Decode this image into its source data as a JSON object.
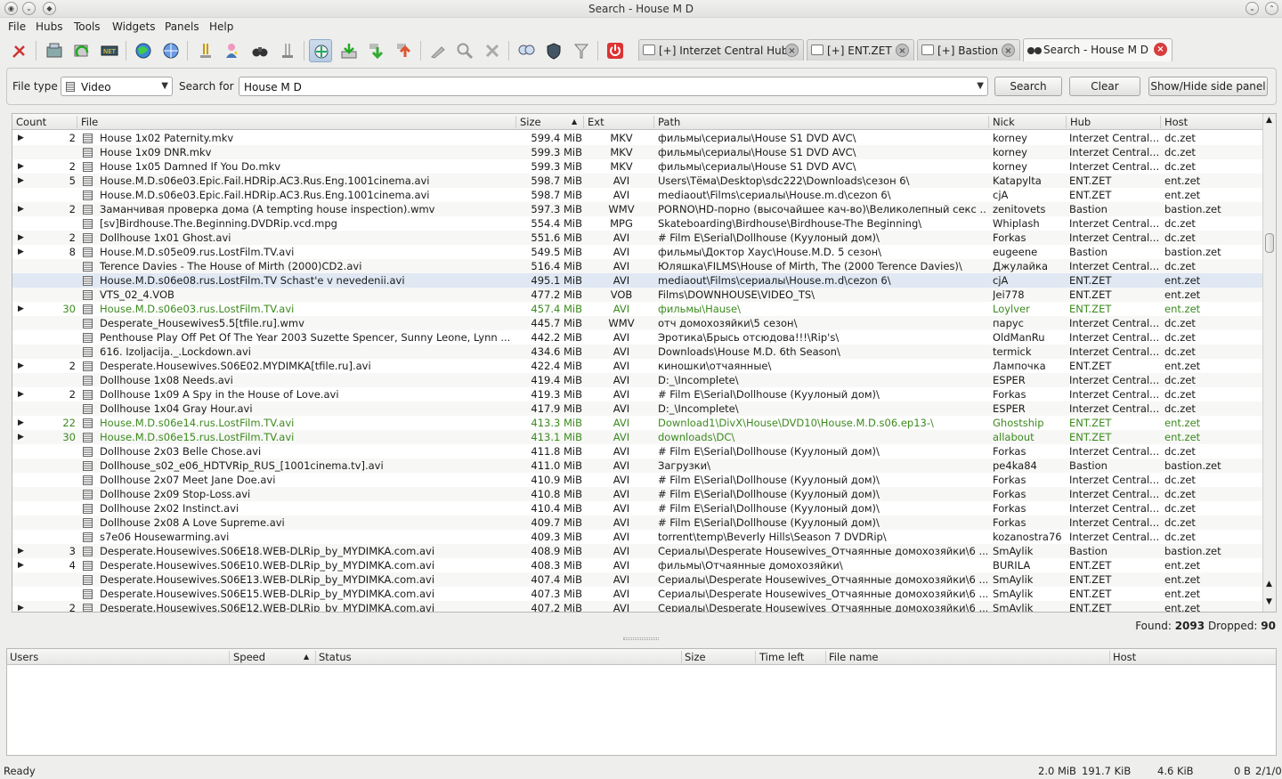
{
  "window": {
    "title": "Search - House M D"
  },
  "menu": [
    "File",
    "Hubs",
    "Tools",
    "Widgets",
    "Panels",
    "Help"
  ],
  "tabs": [
    {
      "label": "[+] Interzet Central Hub"
    },
    {
      "label": "[+] ENT.ZET"
    },
    {
      "label": "[+] Bastion"
    },
    {
      "label": "Search - House M D"
    }
  ],
  "search": {
    "file_type_label": "File type",
    "file_type_value": "Video",
    "search_for_label": "Search for",
    "query": "House M D",
    "search_button": "Search",
    "clear_button": "Clear",
    "side_panel_button": "Show/Hide side panel"
  },
  "columns": {
    "count": "Count",
    "file": "File",
    "size": "Size",
    "ext": "Ext",
    "path": "Path",
    "nick": "Nick",
    "hub": "Hub",
    "host": "Host"
  },
  "rows": [
    {
      "exp": true,
      "count": "2",
      "file": "House 1x02 Paternity.mkv",
      "size": "599.4 MiB",
      "ext": "MKV",
      "path": "фильмы\\сериалы\\House S1 DVD AVC\\",
      "nick": "korney",
      "hub": "Interzet Central...",
      "host": "dc.zet"
    },
    {
      "exp": false,
      "count": "",
      "file": "House 1x09 DNR.mkv",
      "size": "599.3 MiB",
      "ext": "MKV",
      "path": "фильмы\\сериалы\\House S1 DVD AVC\\",
      "nick": "korney",
      "hub": "Interzet Central...",
      "host": "dc.zet"
    },
    {
      "exp": true,
      "count": "2",
      "file": "House 1x05 Damned If You Do.mkv",
      "size": "599.3 MiB",
      "ext": "MKV",
      "path": "фильмы\\сериалы\\House S1 DVD AVC\\",
      "nick": "korney",
      "hub": "Interzet Central...",
      "host": "dc.zet"
    },
    {
      "exp": true,
      "count": "5",
      "file": "House.M.D.s06e03.Epic.Fail.HDRip.AC3.Rus.Eng.1001cinema.avi",
      "size": "598.7 MiB",
      "ext": "AVI",
      "path": "Users\\Тёма\\Desktop\\sdc222\\Downloads\\сезон 6\\",
      "nick": "Katapylta",
      "hub": "ENT.ZET",
      "host": "ent.zet"
    },
    {
      "exp": false,
      "count": "",
      "file": "House.M.D.s06e03.Epic.Fail.HDRip.AC3.Rus.Eng.1001cinema.avi",
      "size": "598.7 MiB",
      "ext": "AVI",
      "path": "mediaout\\Films\\сериалы\\House.m.d\\cezon 6\\",
      "nick": "cjA",
      "hub": "ENT.ZET",
      "host": "ent.zet"
    },
    {
      "exp": true,
      "count": "2",
      "file": "Заманчивая проверка дома (A tempting house inspection).wmv",
      "size": "597.3 MiB",
      "ext": "WMV",
      "path": "PORNO\\HD-порно (высочайшее кач-во)\\Великолепный секс ...",
      "nick": "zenitovets",
      "hub": "Bastion",
      "host": "bastion.zet"
    },
    {
      "exp": false,
      "count": "",
      "file": "[sv]Birdhouse.The.Beginning.DVDRip.vcd.mpg",
      "size": "554.4 MiB",
      "ext": "MPG",
      "path": "Skateboarding\\Birdhouse\\Birdhouse-The Beginning\\",
      "nick": "Whiplash",
      "hub": "Interzet Central...",
      "host": "dc.zet"
    },
    {
      "exp": true,
      "count": "2",
      "file": "Dollhouse 1x01 Ghost.avi",
      "size": "551.6 MiB",
      "ext": "AVI",
      "path": "# Film E\\Serial\\Dollhouse (Куулоный дом)\\",
      "nick": "Forkas",
      "hub": "Interzet Central...",
      "host": "dc.zet"
    },
    {
      "exp": true,
      "count": "8",
      "file": "House.M.D.s05e09.rus.LostFilm.TV.avi",
      "size": "549.5 MiB",
      "ext": "AVI",
      "path": "фильмы\\Доктор Хаус\\House.M.D. 5 сезон\\",
      "nick": "eugeene",
      "hub": "Bastion",
      "host": "bastion.zet"
    },
    {
      "exp": false,
      "count": "",
      "file": "Terence Davies - The House of Mirth (2000)CD2.avi",
      "size": "516.4 MiB",
      "ext": "AVI",
      "path": "Юляшка\\FILMS\\House of Mirth, The (2000 Terence Davies)\\",
      "nick": "Джулайка",
      "hub": "Interzet Central...",
      "host": "dc.zet"
    },
    {
      "exp": false,
      "count": "",
      "file": "House.M.D.s06e08.rus.LostFilm.TV Schast'e v nevedenii.avi",
      "size": "495.1 MiB",
      "ext": "AVI",
      "path": "mediaout\\Films\\сериалы\\House.m.d\\cezon 6\\",
      "nick": "cjA",
      "hub": "ENT.ZET",
      "host": "ent.zet",
      "sel": true
    },
    {
      "exp": false,
      "count": "",
      "file": "VTS_02_4.VOB",
      "size": "477.2 MiB",
      "ext": "VOB",
      "path": "Films\\DOWNHOUSE\\VIDEO_TS\\",
      "nick": "Jei778",
      "hub": "ENT.ZET",
      "host": "ent.zet"
    },
    {
      "exp": true,
      "count": "30",
      "file": "House.M.D.s06e03.rus.LostFilm.TV.avi",
      "size": "457.4 MiB",
      "ext": "AVI",
      "path": "фильмы\\Hause\\",
      "nick": "Loylver",
      "hub": "ENT.ZET",
      "host": "ent.zet",
      "green": true
    },
    {
      "exp": false,
      "count": "",
      "file": "Desperate_Housewives5.5[tfile.ru].wmv",
      "size": "445.7 MiB",
      "ext": "WMV",
      "path": "отч домохозяйки\\5 сезон\\",
      "nick": "парус",
      "hub": "Interzet Central...",
      "host": "dc.zet"
    },
    {
      "exp": false,
      "count": "",
      "file": "Penthouse Play Off Pet Of The Year 2003 Suzette Spencer, Sunny Leone, Lynn ...",
      "size": "442.2 MiB",
      "ext": "AVI",
      "path": "Эротика\\Брысь отсюдова!!!\\Rip's\\",
      "nick": "OldManRu",
      "hub": "Interzet Central...",
      "host": "dc.zet"
    },
    {
      "exp": false,
      "count": "",
      "file": "616. Izoljacija._.Lockdown.avi",
      "size": "434.6 MiB",
      "ext": "AVI",
      "path": "Downloads\\House M.D. 6th Season\\",
      "nick": "termick",
      "hub": "Interzet Central...",
      "host": "dc.zet"
    },
    {
      "exp": true,
      "count": "2",
      "file": "Desperate.Housewives.S06E02.MYDIMKA[tfile.ru].avi",
      "size": "422.4 MiB",
      "ext": "AVI",
      "path": "киношки\\отчаянные\\",
      "nick": "Лампочка",
      "hub": "ENT.ZET",
      "host": "ent.zet"
    },
    {
      "exp": false,
      "count": "",
      "file": "Dollhouse 1x08 Needs.avi",
      "size": "419.4 MiB",
      "ext": "AVI",
      "path": "D:_\\Incomplete\\",
      "nick": "ESPER",
      "hub": "Interzet Central...",
      "host": "dc.zet"
    },
    {
      "exp": true,
      "count": "2",
      "file": "Dollhouse 1x09 A Spy in the House of Love.avi",
      "size": "419.3 MiB",
      "ext": "AVI",
      "path": "# Film E\\Serial\\Dollhouse (Куулоный дом)\\",
      "nick": "Forkas",
      "hub": "Interzet Central...",
      "host": "dc.zet"
    },
    {
      "exp": false,
      "count": "",
      "file": "Dollhouse 1x04 Gray Hour.avi",
      "size": "417.9 MiB",
      "ext": "AVI",
      "path": "D:_\\Incomplete\\",
      "nick": "ESPER",
      "hub": "Interzet Central...",
      "host": "dc.zet"
    },
    {
      "exp": true,
      "count": "22",
      "file": "House.M.D.s06e14.rus.LostFilm.TV.avi",
      "size": "413.3 MiB",
      "ext": "AVI",
      "path": "Download1\\DivX\\House\\DVD10\\House.M.D.s06.ep13-\\",
      "nick": "Ghostship",
      "hub": "ENT.ZET",
      "host": "ent.zet",
      "green": true
    },
    {
      "exp": true,
      "count": "30",
      "file": "House.M.D.s06e15.rus.LostFilm.TV.avi",
      "size": "413.1 MiB",
      "ext": "AVI",
      "path": "downloads\\DC\\",
      "nick": "allabout",
      "hub": "ENT.ZET",
      "host": "ent.zet",
      "green": true
    },
    {
      "exp": false,
      "count": "",
      "file": "Dollhouse 2x03 Belle Chose.avi",
      "size": "411.8 MiB",
      "ext": "AVI",
      "path": "# Film E\\Serial\\Dollhouse (Куулоный дом)\\",
      "nick": "Forkas",
      "hub": "Interzet Central...",
      "host": "dc.zet"
    },
    {
      "exp": false,
      "count": "",
      "file": "Dollhouse_s02_e06_HDTVRip_RUS_[1001cinema.tv].avi",
      "size": "411.0 MiB",
      "ext": "AVI",
      "path": "Загрузки\\",
      "nick": "pe4ka84",
      "hub": "Bastion",
      "host": "bastion.zet"
    },
    {
      "exp": false,
      "count": "",
      "file": "Dollhouse 2x07 Meet Jane Doe.avi",
      "size": "410.9 MiB",
      "ext": "AVI",
      "path": "# Film E\\Serial\\Dollhouse (Куулоный дом)\\",
      "nick": "Forkas",
      "hub": "Interzet Central...",
      "host": "dc.zet"
    },
    {
      "exp": false,
      "count": "",
      "file": "Dollhouse 2x09 Stop-Loss.avi",
      "size": "410.8 MiB",
      "ext": "AVI",
      "path": "# Film E\\Serial\\Dollhouse (Куулоный дом)\\",
      "nick": "Forkas",
      "hub": "Interzet Central...",
      "host": "dc.zet"
    },
    {
      "exp": false,
      "count": "",
      "file": "Dollhouse 2x02 Instinct.avi",
      "size": "410.4 MiB",
      "ext": "AVI",
      "path": "# Film E\\Serial\\Dollhouse (Куулоный дом)\\",
      "nick": "Forkas",
      "hub": "Interzet Central...",
      "host": "dc.zet"
    },
    {
      "exp": false,
      "count": "",
      "file": "Dollhouse 2x08 A Love Supreme.avi",
      "size": "409.7 MiB",
      "ext": "AVI",
      "path": "# Film E\\Serial\\Dollhouse (Куулоный дом)\\",
      "nick": "Forkas",
      "hub": "Interzet Central...",
      "host": "dc.zet"
    },
    {
      "exp": false,
      "count": "",
      "file": "s7e06 Housewarming.avi",
      "size": "409.3 MiB",
      "ext": "AVI",
      "path": "torrent\\temp\\Beverly Hills\\Season 7 DVDRip\\",
      "nick": "kozanostra76",
      "hub": "Interzet Central...",
      "host": "dc.zet"
    },
    {
      "exp": true,
      "count": "3",
      "file": "Desperate.Housewives.S06E18.WEB-DLRip_by_MYDIMKA.com.avi",
      "size": "408.9 MiB",
      "ext": "AVI",
      "path": "Сериалы\\Desperate Housewives_Отчаянные домохозяйки\\6 ...",
      "nick": "SmAylik",
      "hub": "Bastion",
      "host": "bastion.zet"
    },
    {
      "exp": true,
      "count": "4",
      "file": "Desperate.Housewives.S06E10.WEB-DLRip_by_MYDIMKA.com.avi",
      "size": "408.3 MiB",
      "ext": "AVI",
      "path": "фильмы\\Отчаянные домохозяйки\\",
      "nick": "BURILA",
      "hub": "ENT.ZET",
      "host": "ent.zet"
    },
    {
      "exp": false,
      "count": "",
      "file": "Desperate.Housewives.S06E13.WEB-DLRip_by_MYDIMKA.com.avi",
      "size": "407.4 MiB",
      "ext": "AVI",
      "path": "Сериалы\\Desperate Housewives_Отчаянные домохозяйки\\6 ...",
      "nick": "SmAylik",
      "hub": "ENT.ZET",
      "host": "ent.zet"
    },
    {
      "exp": false,
      "count": "",
      "file": "Desperate.Housewives.S06E15.WEB-DLRip_by_MYDIMKA.com.avi",
      "size": "407.3 MiB",
      "ext": "AVI",
      "path": "Сериалы\\Desperate Housewives_Отчаянные домохозяйки\\6 ...",
      "nick": "SmAylik",
      "hub": "ENT.ZET",
      "host": "ent.zet"
    },
    {
      "exp": true,
      "count": "2",
      "file": "Desperate.Housewives.S06E12.WEB-DLRip_by_MYDIMKA.com.avi",
      "size": "407.2 MiB",
      "ext": "AVI",
      "path": "Сериалы\\Desperate Housewives_Отчаянные домохозяйки\\6 ...",
      "nick": "SmAylik",
      "hub": "ENT.ZET",
      "host": "ent.zet"
    }
  ],
  "found": {
    "found_label": "Found:",
    "found_value": "2093",
    "dropped_label": "Dropped:",
    "dropped_value": "90"
  },
  "transfer_columns": {
    "users": "Users",
    "speed": "Speed",
    "status": "Status",
    "size": "Size",
    "time_left": "Time left",
    "file_name": "File name",
    "host": "Host"
  },
  "statusbar": {
    "status": "Ready",
    "total": "2.0 MiB",
    "down": "191.7 KiB",
    "up": "4.6 KiB",
    "speed": "0 B",
    "slots": "2/1/0"
  },
  "colors": {
    "green_row": "#3c8a1e",
    "selection": "#dfe8f3",
    "close_red": "#d63d3d"
  }
}
